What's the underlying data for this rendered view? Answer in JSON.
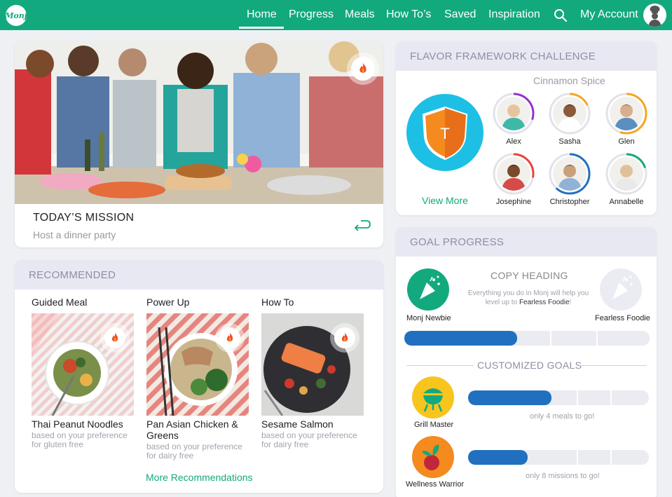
{
  "nav": {
    "logo": "Monj",
    "items": [
      "Home",
      "Progress",
      "Meals",
      "How To’s",
      "Saved",
      "Inspiration"
    ],
    "account": "My Account",
    "icons": {
      "search": "search-icon",
      "avatar": "chef-avatar-icon"
    }
  },
  "mission": {
    "title": "TODAY’S MISSION",
    "subtitle": "Host a dinner party"
  },
  "recommended": {
    "heading": "RECOMMENDED",
    "items": [
      {
        "category": "Guided Meal",
        "name": "Thai Peanut Noodles",
        "note": "based on your preference for gluten free"
      },
      {
        "category": "Power Up",
        "name": "Pan Asian Chicken & Greens",
        "note": "based on your preference for dairy free"
      },
      {
        "category": "How To",
        "name": "Sesame Salmon",
        "note": "based on your preference for dairy free"
      }
    ],
    "more": "More Recommendations"
  },
  "challenge": {
    "heading": "FLAVOR FRAMEWORK CHALLENGE",
    "name": "Cinnamon Spice",
    "team_letter": "T",
    "view_more": "View More",
    "members": [
      {
        "name": "Alex",
        "progress": 0.3,
        "color": "#9b2fd0"
      },
      {
        "name": "Sasha",
        "progress": 0.18,
        "color": "#f5a623"
      },
      {
        "name": "Glen",
        "progress": 0.55,
        "color": "#f5a623"
      },
      {
        "name": "Josephine",
        "progress": 0.28,
        "color": "#e8443a"
      },
      {
        "name": "Christopher",
        "progress": 0.62,
        "color": "#2170bf"
      },
      {
        "name": "Annabelle",
        "progress": 0.2,
        "color": "#12a97e"
      }
    ]
  },
  "goals": {
    "heading": "GOAL PROGRESS",
    "copy_heading": "COPY HEADING",
    "copy_body_prefix": "Everything you do in Monj will help you level up to ",
    "copy_body_target": "Fearless Foodie",
    "copy_body_suffix": "!",
    "current_level": "Monj Newbie",
    "next_level": "Fearless Foodie",
    "level_progress": 0.46,
    "customized_heading": "CUSTOMIZED GOALS",
    "custom": [
      {
        "name": "Grill Master",
        "note": "only 4 meals to go!",
        "progress": 0.46
      },
      {
        "name": "Wellness Warrior",
        "note": "only 8 missions to go!",
        "progress": 0.33
      }
    ],
    "colors": {
      "bar": "#2170bf",
      "green": "#12a97e",
      "yellow": "#f7c51e",
      "orange": "#f58a1f"
    }
  }
}
